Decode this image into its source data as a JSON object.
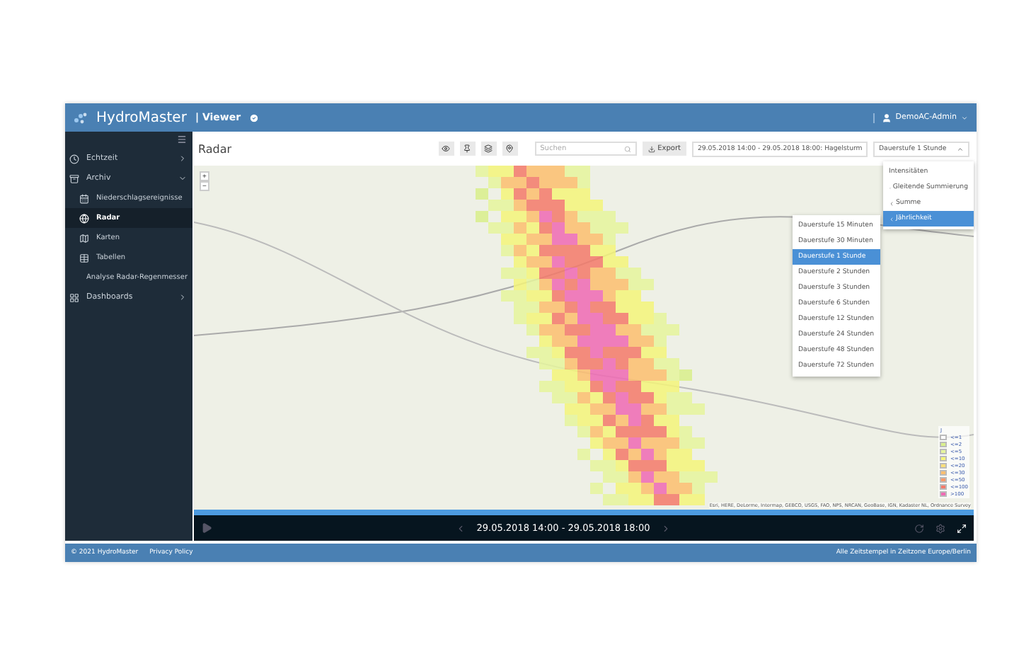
{
  "header": {
    "app_name": "HydroMaster",
    "module": "| Viewer",
    "user": "DemoAC-Admin"
  },
  "sidebar": {
    "items": [
      {
        "label": "Echtzeit",
        "expanded": false
      },
      {
        "label": "Archiv",
        "expanded": true,
        "children": [
          {
            "label": "Niederschlagsereignisse",
            "selected": false
          },
          {
            "label": "Radar",
            "selected": true
          },
          {
            "label": "Karten",
            "selected": false
          },
          {
            "label": "Tabellen",
            "selected": false
          },
          {
            "label": "Analyse Radar-Regenmesser",
            "selected": false
          }
        ]
      },
      {
        "label": "Dashboards",
        "expanded": false
      }
    ]
  },
  "page_title": "Radar",
  "toolbar": {
    "search": {
      "placeholder": "Suchen"
    },
    "export": "Export",
    "event_select": "29.05.2018 14:00 - 29.05.2018 18:00: Hagelsturm",
    "product_select": "Dauerstufe 1 Stunde"
  },
  "product_menu": [
    {
      "label": "Intensitäten",
      "submenu": false,
      "selected": false
    },
    {
      "label": "Gleitende Summierung",
      "submenu": true,
      "selected": false
    },
    {
      "label": "Summe",
      "submenu": true,
      "selected": false
    },
    {
      "label": "Jährlichkeit",
      "submenu": true,
      "selected": true
    }
  ],
  "duration_menu": [
    {
      "label": "Dauerstufe 15 Minuten",
      "selected": false
    },
    {
      "label": "Dauerstufe 30 Minuten",
      "selected": false
    },
    {
      "label": "Dauerstufe 1 Stunde",
      "selected": true
    },
    {
      "label": "Dauerstufe 2 Stunden",
      "selected": false
    },
    {
      "label": "Dauerstufe 3 Stunden",
      "selected": false
    },
    {
      "label": "Dauerstufe 6 Stunden",
      "selected": false
    },
    {
      "label": "Dauerstufe 12 Stunden",
      "selected": false
    },
    {
      "label": "Dauerstufe 24 Stunden",
      "selected": false
    },
    {
      "label": "Dauerstufe 48 Stunden",
      "selected": false
    },
    {
      "label": "Dauerstufe 72 Stunden",
      "selected": false
    }
  ],
  "map": {
    "zoom_in": "+",
    "zoom_out": "−",
    "attribution": "Esri, HERE, DeLorme, Intermap, GEBCO, USGS, FAO, NPS, NRCAN, GeoBase, IGN, Kadaster NL, Ordnance Survey"
  },
  "legend": {
    "title": "J",
    "items": [
      {
        "label": "<=1",
        "color": "#ffffff"
      },
      {
        "label": "<=2",
        "color": "#d9ef8b"
      },
      {
        "label": "<=5",
        "color": "#e6f59d"
      },
      {
        "label": "<=10",
        "color": "#f5f57a"
      },
      {
        "label": "<=20",
        "color": "#fde07a"
      },
      {
        "label": "<=30",
        "color": "#fdbf6f"
      },
      {
        "label": "<=50",
        "color": "#fb9a6a"
      },
      {
        "label": "<=100",
        "color": "#f47a6a"
      },
      {
        "label": ">100",
        "color": "#f06ab4"
      }
    ]
  },
  "player": {
    "range": "29.05.2018 14:00 - 29.05.2018 18:00"
  },
  "footer": {
    "copyright": "© 2021 HydroMaster",
    "privacy": "Privacy Policy",
    "timezone": "Alle Zeitstempel in Zeitzone Europe/Berlin"
  }
}
